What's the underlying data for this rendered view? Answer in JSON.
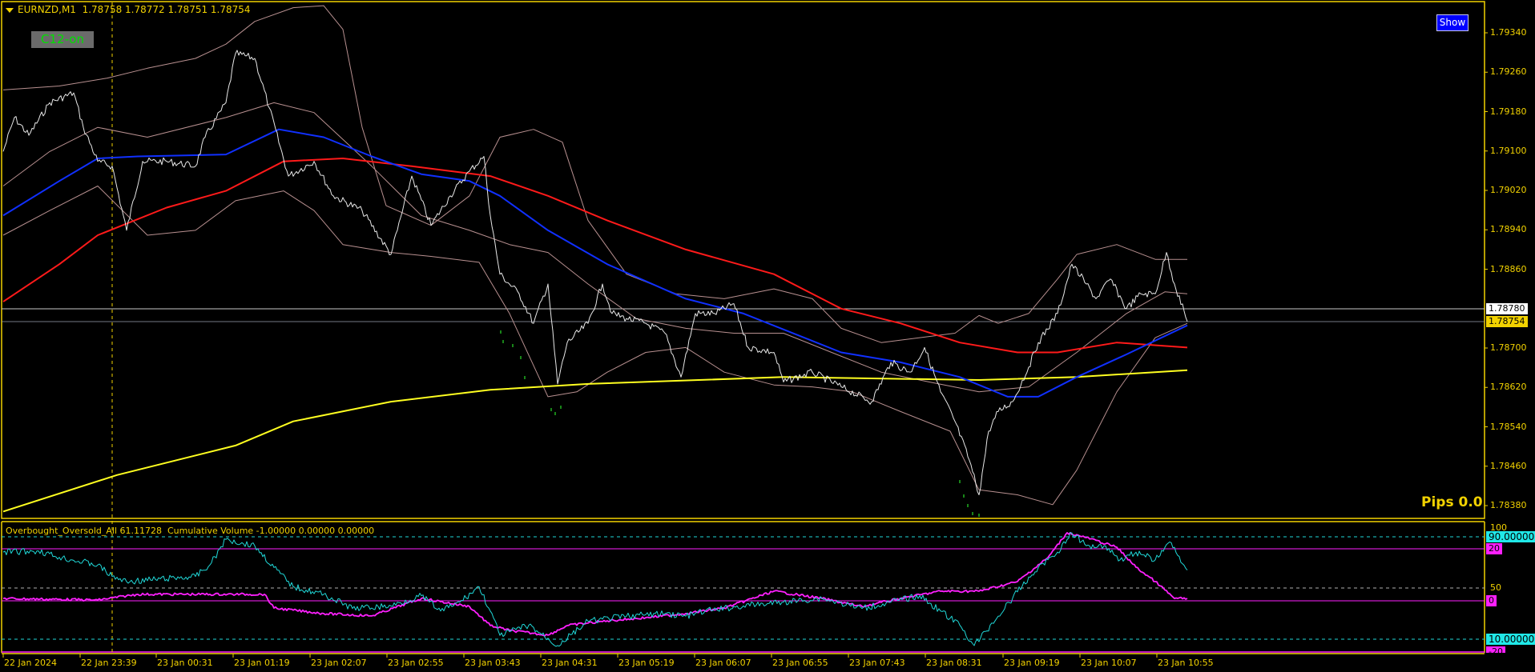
{
  "header": {
    "symbol": "EURNZD,M1",
    "ohlc": "1.78758 1.78772 1.78751 1.78754"
  },
  "status_label": "C12-on",
  "show_button": "Show",
  "pips_label": "Pips 0.0",
  "indicator_header": "Overbought_Oversold_All 61.11728  Cumulative Volume -1.00000 0.00000 0.00000",
  "price_axis": [
    "1.79340",
    "1.79260",
    "1.79180",
    "1.79100",
    "1.79020",
    "1.78940",
    "1.78860",
    "1.78700",
    "1.78620",
    "1.78540",
    "1.78460",
    "1.78380"
  ],
  "price_markers": {
    "line_price": "1.78780",
    "bid": "1.78754"
  },
  "indicator_axis": {
    "top": "100",
    "mid": "50",
    "level_high": "90.00000",
    "level_low": "10.00000",
    "cv_high": "20",
    "cv_zero": "0",
    "cv_low": "-20"
  },
  "time_axis": [
    "22 Jan 2024",
    "22 Jan 23:39",
    "23 Jan 00:31",
    "23 Jan 01:19",
    "23 Jan 02:07",
    "23 Jan 02:55",
    "23 Jan 03:43",
    "23 Jan 04:31",
    "23 Jan 05:19",
    "23 Jan 06:07",
    "23 Jan 06:55",
    "23 Jan 07:43",
    "23 Jan 08:31",
    "23 Jan 09:19",
    "23 Jan 10:07",
    "23 Jan 10:55"
  ],
  "colors": {
    "axis": "#f2d200",
    "price": "#e8e8e8",
    "ma_fast": "#1030ff",
    "ma_mid": "#ff1a1a",
    "ma_slow": "#ffff20",
    "bands": "#b89090",
    "osc": "#20d8d8",
    "cumvol": "#ff20ff"
  },
  "chart_data": {
    "type": "line",
    "price_series": {
      "price": [
        [
          0,
          1.79099
        ],
        [
          7,
          1.79168
        ],
        [
          16,
          1.79132
        ],
        [
          29,
          1.79198
        ],
        [
          44,
          1.79218
        ],
        [
          50,
          1.79148
        ],
        [
          59,
          1.79079
        ],
        [
          68,
          1.79069
        ],
        [
          77,
          1.78939
        ],
        [
          87,
          1.79079
        ],
        [
          102,
          1.79079
        ],
        [
          120,
          1.79069
        ],
        [
          126,
          1.79128
        ],
        [
          139,
          1.79198
        ],
        [
          145,
          1.79298
        ],
        [
          157,
          1.79288
        ],
        [
          166,
          1.79188
        ],
        [
          178,
          1.79049
        ],
        [
          194,
          1.79079
        ],
        [
          206,
          1.79009
        ],
        [
          224,
          1.78979
        ],
        [
          242,
          1.7889
        ],
        [
          255,
          1.79049
        ],
        [
          267,
          1.78949
        ],
        [
          279,
          1.79009
        ],
        [
          291,
          1.79059
        ],
        [
          300,
          1.79089
        ],
        [
          304,
          1.78969
        ],
        [
          310,
          1.7885
        ],
        [
          322,
          1.7881
        ],
        [
          331,
          1.7875
        ],
        [
          340,
          1.7883
        ],
        [
          346,
          1.78627
        ],
        [
          352,
          1.78711
        ],
        [
          365,
          1.7875
        ],
        [
          374,
          1.7883
        ],
        [
          380,
          1.7877
        ],
        [
          389,
          1.7876
        ],
        [
          401,
          1.7875
        ],
        [
          413,
          1.7873
        ],
        [
          423,
          1.78641
        ],
        [
          432,
          1.7877
        ],
        [
          444,
          1.7877
        ],
        [
          456,
          1.7879
        ],
        [
          465,
          1.78701
        ],
        [
          481,
          1.78691
        ],
        [
          487,
          1.78631
        ],
        [
          505,
          1.78651
        ],
        [
          523,
          1.78621
        ],
        [
          542,
          1.78591
        ],
        [
          554,
          1.78671
        ],
        [
          566,
          1.78651
        ],
        [
          575,
          1.78701
        ],
        [
          585,
          1.78611
        ],
        [
          594,
          1.78551
        ],
        [
          603,
          1.78472
        ],
        [
          609,
          1.78402
        ],
        [
          615,
          1.78531
        ],
        [
          621,
          1.78571
        ],
        [
          630,
          1.78591
        ],
        [
          640,
          1.78661
        ],
        [
          646,
          1.78711
        ],
        [
          658,
          1.7877
        ],
        [
          667,
          1.7887
        ],
        [
          676,
          1.7883
        ],
        [
          682,
          1.788
        ],
        [
          691,
          1.7884
        ],
        [
          701,
          1.7878
        ],
        [
          710,
          1.7881
        ],
        [
          719,
          1.7881
        ],
        [
          726,
          1.78894
        ],
        [
          731,
          1.7883
        ],
        [
          739,
          1.78754
        ]
      ],
      "ma_fast": [
        [
          0,
          1.78969
        ],
        [
          35,
          1.79039
        ],
        [
          59,
          1.79085
        ],
        [
          84,
          1.79089
        ],
        [
          139,
          1.79093
        ],
        [
          172,
          1.79144
        ],
        [
          200,
          1.79128
        ],
        [
          230,
          1.79089
        ],
        [
          261,
          1.79053
        ],
        [
          291,
          1.79039
        ],
        [
          310,
          1.79009
        ],
        [
          340,
          1.78939
        ],
        [
          377,
          1.7887
        ],
        [
          426,
          1.788
        ],
        [
          462,
          1.7877
        ],
        [
          523,
          1.78691
        ],
        [
          560,
          1.78671
        ],
        [
          597,
          1.78641
        ],
        [
          627,
          1.78601
        ],
        [
          646,
          1.78601
        ],
        [
          670,
          1.78641
        ],
        [
          701,
          1.78687
        ],
        [
          739,
          1.78746
        ]
      ],
      "ma_mid": [
        [
          0,
          1.78794
        ],
        [
          35,
          1.7887
        ],
        [
          59,
          1.78929
        ],
        [
          102,
          1.78985
        ],
        [
          139,
          1.79019
        ],
        [
          175,
          1.79079
        ],
        [
          212,
          1.79085
        ],
        [
          255,
          1.79069
        ],
        [
          304,
          1.79049
        ],
        [
          340,
          1.79009
        ],
        [
          377,
          1.78959
        ],
        [
          426,
          1.789
        ],
        [
          481,
          1.7885
        ],
        [
          523,
          1.7878
        ],
        [
          560,
          1.7875
        ],
        [
          597,
          1.78711
        ],
        [
          633,
          1.78691
        ],
        [
          658,
          1.78691
        ],
        [
          695,
          1.78711
        ],
        [
          739,
          1.78701
        ]
      ],
      "ma_slow": [
        [
          0,
          1.78368
        ],
        [
          71,
          1.78442
        ],
        [
          145,
          1.78502
        ],
        [
          181,
          1.78551
        ],
        [
          242,
          1.78591
        ],
        [
          304,
          1.78615
        ],
        [
          365,
          1.78627
        ],
        [
          487,
          1.78641
        ],
        [
          609,
          1.78635
        ],
        [
          670,
          1.78641
        ],
        [
          739,
          1.78655
        ]
      ],
      "band_upper": [
        [
          0,
          1.79224
        ],
        [
          35,
          1.79232
        ],
        [
          65,
          1.79248
        ],
        [
          90,
          1.79268
        ],
        [
          120,
          1.79288
        ],
        [
          139,
          1.79317
        ],
        [
          157,
          1.79363
        ],
        [
          181,
          1.79391
        ],
        [
          200,
          1.79395
        ],
        [
          212,
          1.79347
        ],
        [
          224,
          1.79148
        ],
        [
          239,
          1.78989
        ],
        [
          267,
          1.78949
        ],
        [
          291,
          1.79009
        ],
        [
          310,
          1.79128
        ],
        [
          331,
          1.79144
        ],
        [
          349,
          1.79118
        ],
        [
          365,
          1.78959
        ],
        [
          389,
          1.7885
        ],
        [
          420,
          1.7881
        ],
        [
          450,
          1.788
        ],
        [
          481,
          1.7882
        ],
        [
          505,
          1.788
        ],
        [
          523,
          1.7874
        ],
        [
          548,
          1.78711
        ],
        [
          572,
          1.78721
        ],
        [
          594,
          1.7873
        ],
        [
          609,
          1.78766
        ],
        [
          621,
          1.7875
        ],
        [
          640,
          1.7877
        ],
        [
          658,
          1.7884
        ],
        [
          670,
          1.7889
        ],
        [
          695,
          1.7891
        ],
        [
          719,
          1.7888
        ],
        [
          739,
          1.7888
        ]
      ],
      "band_middle": [
        [
          0,
          1.79029
        ],
        [
          29,
          1.79099
        ],
        [
          59,
          1.79148
        ],
        [
          90,
          1.79128
        ],
        [
          139,
          1.79168
        ],
        [
          169,
          1.79198
        ],
        [
          194,
          1.79178
        ],
        [
          230,
          1.79069
        ],
        [
          261,
          1.78969
        ],
        [
          291,
          1.78939
        ],
        [
          316,
          1.7891
        ],
        [
          340,
          1.78894
        ],
        [
          365,
          1.7883
        ],
        [
          395,
          1.7876
        ],
        [
          426,
          1.7874
        ],
        [
          456,
          1.7873
        ],
        [
          487,
          1.7873
        ],
        [
          517,
          1.78691
        ],
        [
          548,
          1.78651
        ],
        [
          578,
          1.78631
        ],
        [
          609,
          1.78611
        ],
        [
          640,
          1.78621
        ],
        [
          670,
          1.78691
        ],
        [
          701,
          1.7877
        ],
        [
          725,
          1.78814
        ],
        [
          739,
          1.7881
        ]
      ],
      "band_lower": [
        [
          0,
          1.78929
        ],
        [
          29,
          1.78979
        ],
        [
          59,
          1.79029
        ],
        [
          90,
          1.78929
        ],
        [
          120,
          1.78939
        ],
        [
          145,
          1.78999
        ],
        [
          175,
          1.79019
        ],
        [
          194,
          1.78979
        ],
        [
          212,
          1.7891
        ],
        [
          242,
          1.78894
        ],
        [
          267,
          1.78886
        ],
        [
          297,
          1.78874
        ],
        [
          316,
          1.7877
        ],
        [
          340,
          1.78601
        ],
        [
          358,
          1.78611
        ],
        [
          377,
          1.78651
        ],
        [
          401,
          1.78691
        ],
        [
          426,
          1.78701
        ],
        [
          450,
          1.78651
        ],
        [
          481,
          1.78625
        ],
        [
          505,
          1.78621
        ],
        [
          530,
          1.78611
        ],
        [
          560,
          1.78571
        ],
        [
          591,
          1.78531
        ],
        [
          609,
          1.78412
        ],
        [
          633,
          1.78402
        ],
        [
          655,
          1.78382
        ],
        [
          670,
          1.78452
        ],
        [
          695,
          1.78611
        ],
        [
          719,
          1.78721
        ],
        [
          739,
          1.7875
        ]
      ]
    },
    "indicator_series": {
      "overbought_oversold": [
        [
          0,
          78
        ],
        [
          22,
          79
        ],
        [
          35,
          74
        ],
        [
          59,
          68
        ],
        [
          68,
          59
        ],
        [
          77,
          55
        ],
        [
          120,
          59
        ],
        [
          129,
          68
        ],
        [
          139,
          88
        ],
        [
          157,
          83
        ],
        [
          169,
          66
        ],
        [
          181,
          51
        ],
        [
          200,
          45
        ],
        [
          218,
          34
        ],
        [
          242,
          36
        ],
        [
          261,
          44
        ],
        [
          273,
          32
        ],
        [
          285,
          39
        ],
        [
          297,
          51
        ],
        [
          304,
          32
        ],
        [
          310,
          13
        ],
        [
          328,
          21
        ],
        [
          346,
          5
        ],
        [
          365,
          24
        ],
        [
          389,
          28
        ],
        [
          413,
          30
        ],
        [
          426,
          28
        ],
        [
          438,
          32
        ],
        [
          462,
          36
        ],
        [
          487,
          39
        ],
        [
          511,
          42
        ],
        [
          536,
          34
        ],
        [
          554,
          39
        ],
        [
          572,
          44
        ],
        [
          585,
          32
        ],
        [
          597,
          21
        ],
        [
          606,
          5
        ],
        [
          621,
          28
        ],
        [
          633,
          47
        ],
        [
          646,
          66
        ],
        [
          658,
          78
        ],
        [
          667,
          93
        ],
        [
          676,
          83
        ],
        [
          688,
          83
        ],
        [
          697,
          72
        ],
        [
          707,
          78
        ],
        [
          719,
          72
        ],
        [
          728,
          86
        ],
        [
          739,
          64
        ]
      ],
      "cumulative_volume": [
        [
          0,
          0.9
        ],
        [
          59,
          0.3
        ],
        [
          84,
          2.5
        ],
        [
          163,
          2.5
        ],
        [
          169,
          -2.8
        ],
        [
          200,
          -4.9
        ],
        [
          230,
          -5.8
        ],
        [
          261,
          0.9
        ],
        [
          291,
          -2.2
        ],
        [
          304,
          -9.5
        ],
        [
          316,
          -11.4
        ],
        [
          340,
          -13.2
        ],
        [
          352,
          -9.5
        ],
        [
          377,
          -7.7
        ],
        [
          401,
          -6.5
        ],
        [
          426,
          -4.9
        ],
        [
          450,
          -2.8
        ],
        [
          481,
          3.7
        ],
        [
          511,
          0.9
        ],
        [
          536,
          -2.2
        ],
        [
          560,
          0.9
        ],
        [
          585,
          3.7
        ],
        [
          609,
          3.7
        ],
        [
          633,
          7.4
        ],
        [
          652,
          16.6
        ],
        [
          664,
          26.2
        ],
        [
          676,
          24.3
        ],
        [
          695,
          20.6
        ],
        [
          707,
          12.9
        ],
        [
          719,
          7.4
        ],
        [
          731,
          0.9
        ],
        [
          739,
          0.9
        ]
      ]
    },
    "price_range": [
      1.7833,
      1.794
    ],
    "indicator_range": [
      0,
      100
    ],
    "cumulative_volume_range": [
      -20,
      20
    ]
  }
}
